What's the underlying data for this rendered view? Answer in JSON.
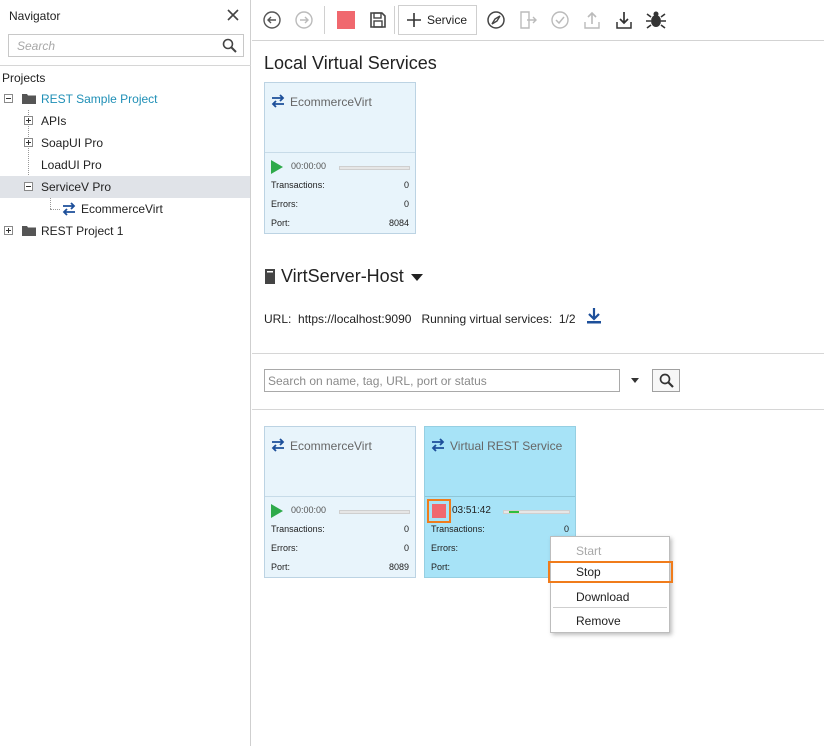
{
  "navigator": {
    "title": "Navigator",
    "search_placeholder": "Search",
    "projects_label": "Projects",
    "tree": {
      "rest_sample_project": "REST Sample Project",
      "apis": "APIs",
      "soapui_pro": "SoapUI Pro",
      "loadui_pro": "LoadUI Pro",
      "servicev_pro": "ServiceV Pro",
      "ecommerce_virt": "EcommerceVirt",
      "rest_project_1": "REST Project 1"
    }
  },
  "toolbar": {
    "service_label": "Service",
    "icons": [
      "back-icon",
      "forward-icon",
      "stop-icon",
      "save-icon",
      "plus-icon",
      "compass-icon",
      "export-icon",
      "check-icon",
      "upload-icon",
      "download-icon",
      "bug-icon"
    ]
  },
  "local_section": {
    "title": "Local Virtual Services",
    "card": {
      "name": "EcommerceVirt",
      "timer": "00:00:00",
      "transactions_label": "Transactions:",
      "transactions": "0",
      "errors_label": "Errors:",
      "errors": "0",
      "port_label": "Port:",
      "port": "8084"
    }
  },
  "host_section": {
    "title": "VirtServer-Host",
    "url_label": "URL:",
    "url": "https://localhost:9090",
    "running_label": "Running virtual services:",
    "running": "1/2",
    "search_placeholder": "Search on name, tag, URL, port or status",
    "cards": [
      {
        "name": "EcommerceVirt",
        "timer": "00:00:00",
        "transactions_label": "Transactions:",
        "transactions": "0",
        "errors_label": "Errors:",
        "errors": "0",
        "port_label": "Port:",
        "port": "8089",
        "progress": 0
      },
      {
        "name": "Virtual REST Service",
        "timer": "03:51:42",
        "transactions_label": "Transactions:",
        "transactions": "0",
        "errors_label": "Errors:",
        "port_label": "Port:",
        "progress": 0.15
      }
    ]
  },
  "context_menu": {
    "items": [
      "Start",
      "Stop",
      "Download",
      "Remove"
    ]
  },
  "colors": {
    "accent_orange": "#f07c1b",
    "running_card": "#a7e3f7",
    "idle_card": "#e8f4fb",
    "play_green": "#2eaa4a",
    "stop_red": "#f0686e",
    "project_teal": "#1f8fb6"
  }
}
